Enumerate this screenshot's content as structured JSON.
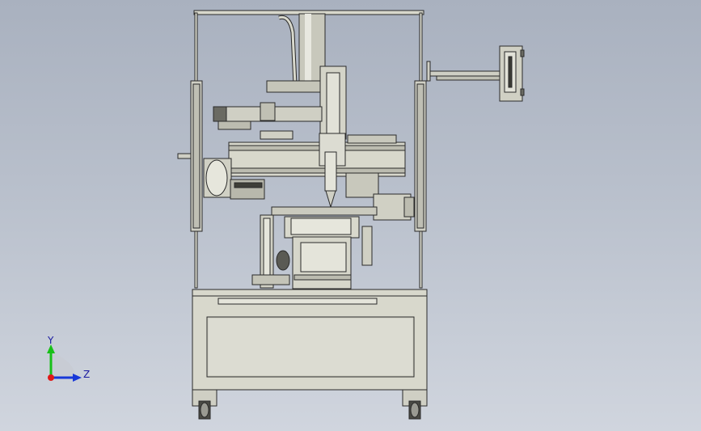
{
  "viewport": {
    "background_top": "#a9b1bf",
    "background_bottom": "#d0d5de"
  },
  "model": {
    "description_icon": "cad-assembly-machine",
    "body_color": "#d8d8cc",
    "edge_color": "#2a2a2a",
    "shadow_color": "#9c9c92"
  },
  "triad": {
    "y_label": "Y",
    "z_label": "Z",
    "y_color": "#18c018",
    "z_color": "#1838d8",
    "x_color": "#e01818"
  }
}
